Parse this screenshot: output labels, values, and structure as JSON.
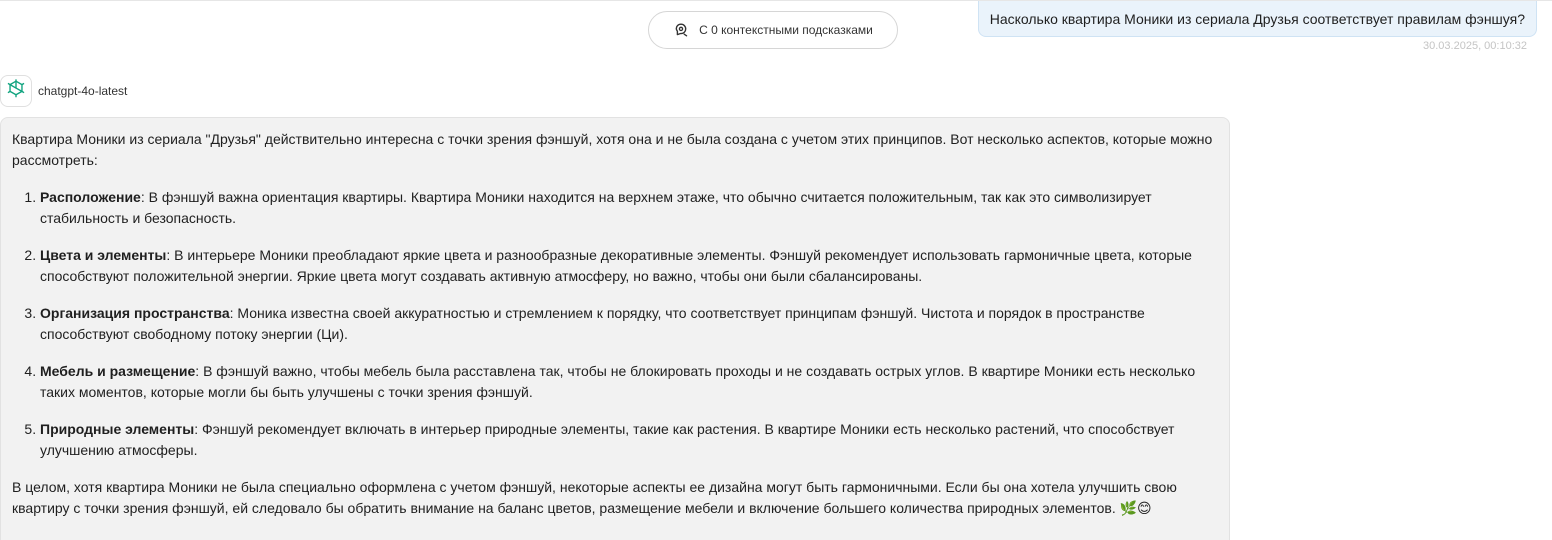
{
  "context_pill": {
    "label": "С 0 контекстными подсказками",
    "icon": "context-hint-icon"
  },
  "user_message": {
    "text": "Насколько квартира Моники из сериала Друзья соответствует правилам фэншуя?",
    "timestamp": "30.03.2025, 00:10:32"
  },
  "model": {
    "name": "chatgpt-4o-latest",
    "icon": "openai-logo-icon"
  },
  "response": {
    "intro": "Квартира Моники из сериала \"Друзья\" действительно интересна с точки зрения фэншуй, хотя она и не была создана с учетом этих принципов. Вот несколько аспектов, которые можно рассмотреть:",
    "items": [
      {
        "title": "Расположение",
        "text": ": В фэншуй важна ориентация квартиры. Квартира Моники находится на верхнем этаже, что обычно считается положительным, так как это символизирует стабильность и безопасность."
      },
      {
        "title": "Цвета и элементы",
        "text": ": В интерьере Моники преобладают яркие цвета и разнообразные декоративные элементы. Фэншуй рекомендует использовать гармоничные цвета, которые способствуют положительной энергии. Яркие цвета могут создавать активную атмосферу, но важно, чтобы они были сбалансированы."
      },
      {
        "title": "Организация пространства",
        "text": ": Моника известна своей аккуратностью и стремлением к порядку, что соответствует принципам фэншуй. Чистота и порядок в пространстве способствуют свободному потоку энергии (Ци)."
      },
      {
        "title": "Мебель и размещение",
        "text": ": В фэншуй важно, чтобы мебель была расставлена так, чтобы не блокировать проходы и не создавать острых углов. В квартире Моники есть несколько таких моментов, которые могли бы быть улучшены с точки зрения фэншуй."
      },
      {
        "title": "Природные элементы",
        "text": ": Фэншуй рекомендует включать в интерьер природные элементы, такие как растения. В квартире Моники есть несколько растений, что способствует улучшению атмосферы."
      }
    ],
    "conclusion": "В целом, хотя квартира Моники не была специально оформлена с учетом фэншуй, некоторые аспекты ее дизайна могут быть гармоничными. Если бы она хотела улучшить свою квартиру с точки зрения фэншуй, ей следовало бы обратить внимание на баланс цветов, размещение мебели и включение большего количества природных элементов.",
    "emoji": "🌿😊"
  }
}
